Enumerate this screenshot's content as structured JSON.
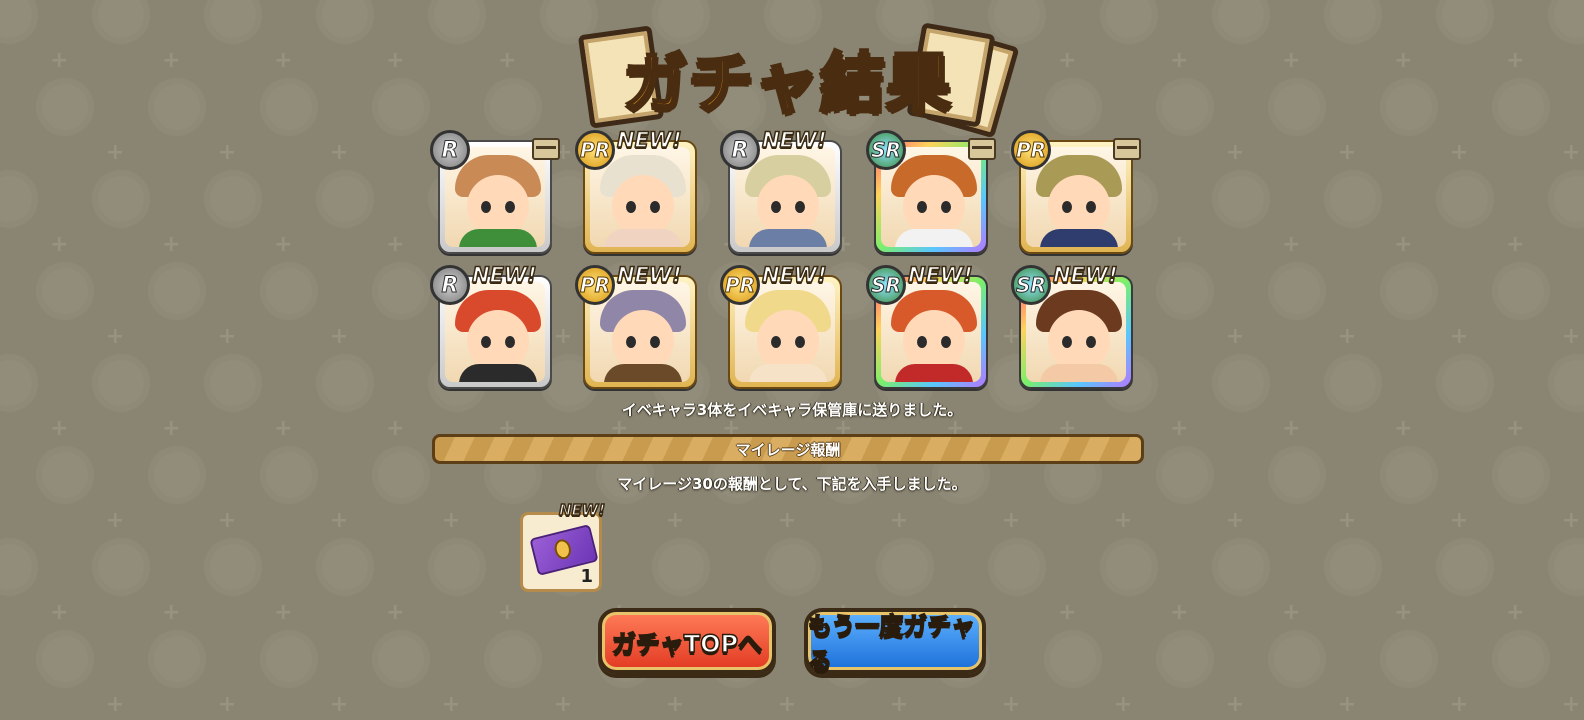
{
  "title": "ガチャ結果",
  "characters": [
    {
      "rank": "R",
      "new": false,
      "new_label": "",
      "storage_icon": true,
      "hair": "#c98a55",
      "body": "#3f8f3a"
    },
    {
      "rank": "PR",
      "new": true,
      "new_label": "NEW!",
      "storage_icon": false,
      "hair": "#e9e1cf",
      "body": "#f0d3c1"
    },
    {
      "rank": "R",
      "new": true,
      "new_label": "NEW!",
      "storage_icon": false,
      "hair": "#d7cfa0",
      "body": "#6b7ea5"
    },
    {
      "rank": "SR",
      "new": false,
      "new_label": "",
      "storage_icon": true,
      "hair": "#c86a2a",
      "body": "#f2f2f2"
    },
    {
      "rank": "PR",
      "new": false,
      "new_label": "",
      "storage_icon": true,
      "hair": "#a99a56",
      "body": "#2f3c6e"
    },
    {
      "rank": "R",
      "new": true,
      "new_label": "NEW!",
      "storage_icon": false,
      "hair": "#d94a2c",
      "body": "#2b2b2b"
    },
    {
      "rank": "PR",
      "new": true,
      "new_label": "NEW!",
      "storage_icon": false,
      "hair": "#8f86a8",
      "body": "#6b4a2a"
    },
    {
      "rank": "PR",
      "new": true,
      "new_label": "NEW!",
      "storage_icon": false,
      "hair": "#f0d98a",
      "body": "#f6e3c7"
    },
    {
      "rank": "SR",
      "new": true,
      "new_label": "NEW!",
      "storage_icon": false,
      "hair": "#d85a2a",
      "body": "#c22a2a"
    },
    {
      "rank": "SR",
      "new": true,
      "new_label": "NEW!",
      "storage_icon": false,
      "hair": "#6b3a1f",
      "body": "#f3c9a6"
    }
  ],
  "info_storage": "イベキャラ3体をイベキャラ保管庫に送りました。",
  "mileage": {
    "header": "マイレージ報酬",
    "message": "マイレージ30の報酬として、下記を入手しました。",
    "reward": {
      "icon": "ticket-icon",
      "new_label": "NEW!",
      "count": "1"
    }
  },
  "buttons": {
    "gacha_top": "ガチャTOPへ",
    "again": "もう一度ガチャる"
  }
}
